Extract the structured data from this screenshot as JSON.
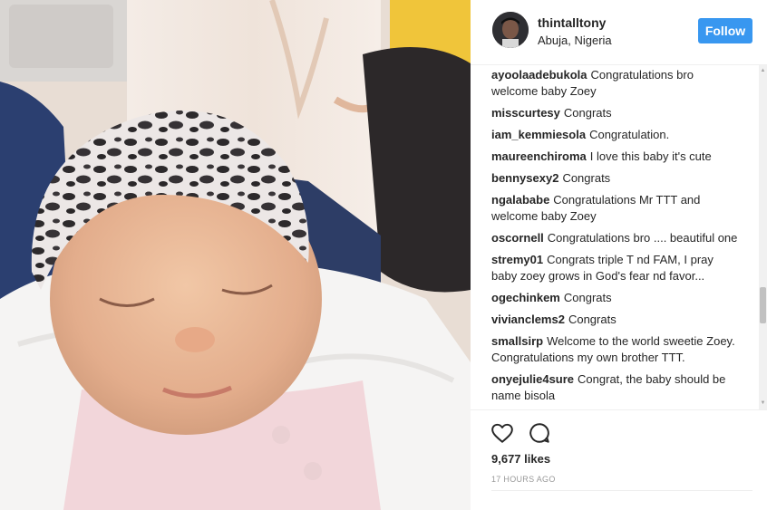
{
  "post": {
    "image_alt": "Sleeping newborn baby in a leopard-print cap",
    "header": {
      "username": "thintalltony",
      "location": "Abuja, Nigeria",
      "follow_label": "Follow"
    },
    "comments": [
      {
        "user": "ayoolaadebukola",
        "text": "Congratulations bro welcome baby Zoey"
      },
      {
        "user": "misscurtesy",
        "text": "Congrats"
      },
      {
        "user": "iam_kemmiesola",
        "text": "Congratulation."
      },
      {
        "user": "maureenchiroma",
        "text": "I love this baby it's cute"
      },
      {
        "user": "bennysexy2",
        "text": "Congrats"
      },
      {
        "user": "ngalababe",
        "text": "Congratulations Mr TTT and welcome baby Zoey"
      },
      {
        "user": "oscornell",
        "text": "Congratulations bro .... beautiful one"
      },
      {
        "user": "stremy01",
        "text": "Congrats triple T nd FAM, I pray baby zoey grows in God's fear nd favor..."
      },
      {
        "user": "ogechinkem",
        "text": "Congrats"
      },
      {
        "user": "vivianclems2",
        "text": "Congrats"
      },
      {
        "user": "smallsirp",
        "text": "Welcome to the world sweetie Zoey. Congratulations my own brother TTT."
      },
      {
        "user": "onyejulie4sure",
        "text": "Congrat, the baby should be name bisola"
      }
    ],
    "actions": {
      "like_icon": "heart-icon",
      "comment_icon": "comment-bubble-icon",
      "likes_text": "9,677 likes",
      "timestamp": "17 HOURS AGO"
    },
    "colors": {
      "follow_button": "#3897f0",
      "text": "#262626",
      "muted": "#999999",
      "divider": "#efefef"
    }
  }
}
